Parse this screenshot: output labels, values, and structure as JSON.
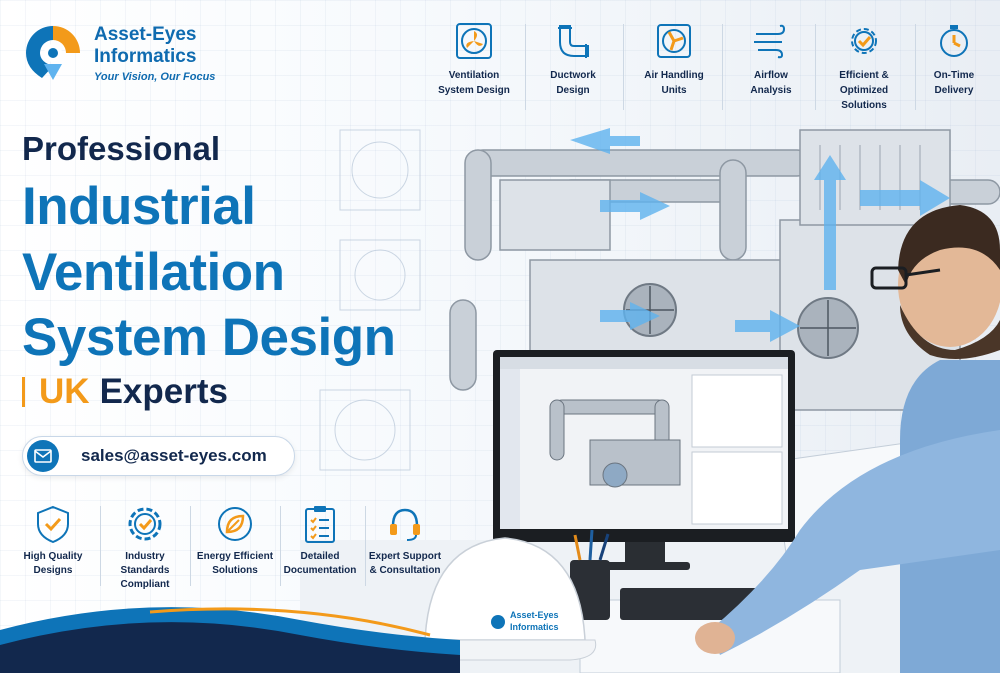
{
  "brand": {
    "name_line1": "Asset-Eyes",
    "name_line2": "Informatics",
    "tagline": "Your Vision, Our Focus",
    "hat_line1": "Asset-Eyes",
    "hat_line2": "Informatics"
  },
  "headline": {
    "line1": "Professional",
    "line2": "Industrial",
    "line3": "Ventilation",
    "line4": "System Design",
    "uk_part1": "UK",
    "uk_part2": "Experts"
  },
  "contact": {
    "email": "sales@asset-eyes.com",
    "icon": "envelope-icon"
  },
  "services": [
    {
      "line1": "Ventilation",
      "line2": "System Design",
      "icon": "fan-icon"
    },
    {
      "line1": "Ductwork",
      "line2": "Design",
      "icon": "duct-icon"
    },
    {
      "line1": "Air Handling",
      "line2": "Units",
      "icon": "air-handler-icon"
    },
    {
      "line1": "Airflow",
      "line2": "Analysis",
      "icon": "airflow-icon"
    },
    {
      "line1": "Efficient &",
      "line2": "Optimized Solutions",
      "icon": "gear-check-icon"
    },
    {
      "line1": "On-Time",
      "line2": "Delivery",
      "icon": "stopwatch-icon"
    }
  ],
  "features": [
    {
      "line1": "High Quality",
      "line2": "Designs",
      "line3": "",
      "icon": "shield-check-icon"
    },
    {
      "line1": "Industry",
      "line2": "Standards",
      "line3": "Compliant",
      "icon": "gear-check-icon"
    },
    {
      "line1": "Energy Efficient",
      "line2": "Solutions",
      "line3": "",
      "icon": "leaf-icon"
    },
    {
      "line1": "Detailed",
      "line2": "Documentation",
      "line3": "",
      "icon": "clipboard-icon"
    },
    {
      "line1": "Expert Support",
      "line2": "& Consultation",
      "line3": "",
      "icon": "headset-icon"
    }
  ],
  "colors": {
    "navy": "#12284d",
    "blue": "#0e74b8",
    "orange": "#f39a1a"
  }
}
